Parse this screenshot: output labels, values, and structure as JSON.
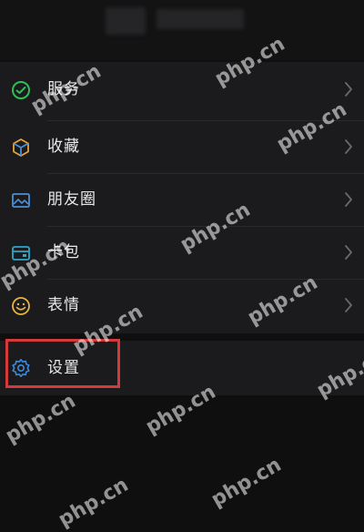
{
  "menu": {
    "items": [
      {
        "label": "服务",
        "icon": "wechat-pay-icon"
      },
      {
        "label": "收藏",
        "icon": "favorites-cube-icon"
      },
      {
        "label": "朋友圈",
        "icon": "moments-photo-icon"
      },
      {
        "label": "卡包",
        "icon": "card-wallet-icon"
      },
      {
        "label": "表情",
        "icon": "emoji-smile-icon"
      }
    ]
  },
  "settings": {
    "label": "设置",
    "icon": "gear-icon"
  },
  "watermark": {
    "text": "php.cn"
  },
  "colors": {
    "background": "#0f0f10",
    "panel": "#1b1b1d",
    "text": "#e8e8e8",
    "highlight": "#d43a3a",
    "service_icon": "#2fbf5a",
    "favorites_icon": "#e6a23c",
    "moments_icon": "#4a8fd6",
    "card_icon": "#2aa7c9",
    "emoji_icon": "#e6b43c",
    "settings_icon": "#3b8be0"
  }
}
